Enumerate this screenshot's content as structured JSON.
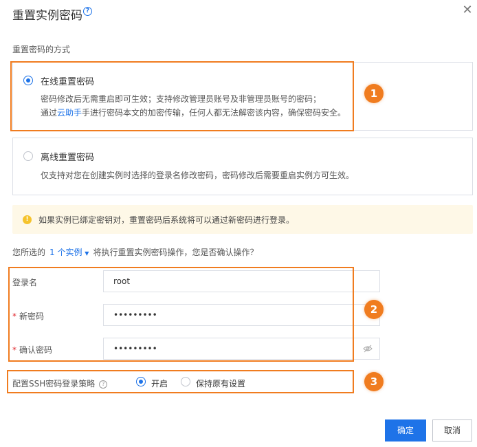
{
  "dialog": {
    "title": "重置实例密码",
    "help_icon_glyph": "?",
    "close_glyph": "✕"
  },
  "method": {
    "section_label": "重置密码的方式",
    "online": {
      "title": "在线重置密码",
      "desc_line1": "密码修改后无需重启即可生效；支持修改管理员账号及非管理员账号的密码；",
      "desc_line2_prefix": "通过",
      "desc_line2_link": "云助手",
      "desc_line2_suffix": "手进行密码本文的加密传输，任何人都无法解密该内容，确保密码安全。",
      "selected": true
    },
    "offline": {
      "title": "离线重置密码",
      "desc": "仅支持对您在创建实例时选择的登录名修改密码，密码修改后需要重启实例方可生效。",
      "selected": false
    }
  },
  "notice": {
    "icon": "warning-icon",
    "icon_glyph": "!",
    "text": "如果实例已绑定密钥对，重置密码后系统将可以通过新密码进行登录。"
  },
  "confirm": {
    "prefix": "您所选的",
    "dropdown_label": "1 个实例",
    "caret": "▼",
    "suffix": "将执行重置实例密码操作，您是否确认操作？"
  },
  "form": {
    "login_label": "登录名",
    "login_value": "root",
    "new_password_label": "新密码",
    "new_password_value": "•••••••••",
    "confirm_password_label": "确认密码",
    "confirm_password_value": "•••••••••",
    "required_mark": "*"
  },
  "ssh": {
    "label": "配置SSH密码登录策略",
    "help_glyph": "?",
    "option_enable": "开启",
    "option_keep": "保持原有设置",
    "selected": "开启"
  },
  "buttons": {
    "ok": "确定",
    "cancel": "取消"
  },
  "annotations": {
    "badge1": "1",
    "badge2": "2",
    "badge3": "3",
    "highlight_color": "#f07c1f"
  },
  "colors": {
    "accent": "#1e73e8",
    "required": "#e0282e",
    "notice_bg": "#fef8e7"
  }
}
